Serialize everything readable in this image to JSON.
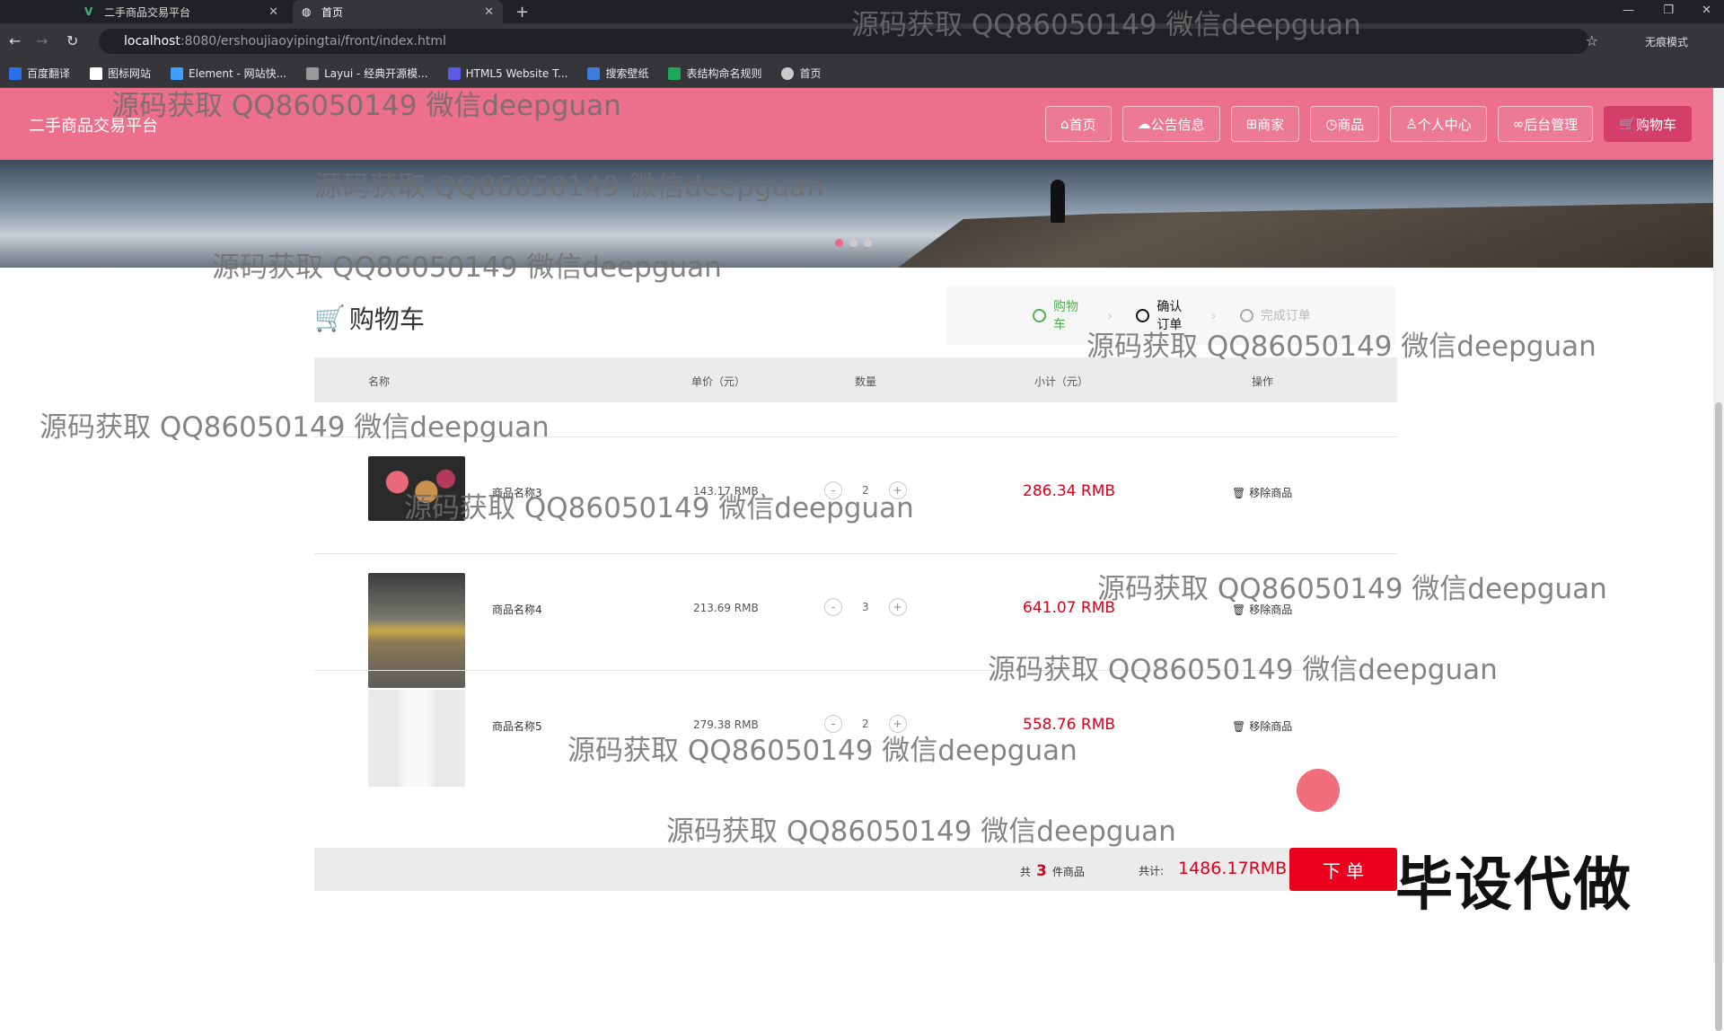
{
  "browser": {
    "tabs": [
      {
        "title": "二手商品交易平台"
      },
      {
        "title": "首页"
      }
    ],
    "url_host": "localhost",
    "url_path": ":8080/ershoujiaoyipingtai/front/index.html",
    "profile_label": "无痕模式",
    "bookmarks": [
      "百度翻译",
      "图标网站",
      "Element - 网站快...",
      "Layui - 经典开源模...",
      "HTML5 Website T...",
      "搜索壁纸",
      "表结构命名规则",
      "首页"
    ]
  },
  "header": {
    "site_title": "二手商品交易平台",
    "nav": [
      "首页",
      "公告信息",
      "商家",
      "商品",
      "个人中心",
      "后台管理",
      "购物车"
    ]
  },
  "cart": {
    "title": "购物车",
    "steps": [
      "购物车",
      "确认订单",
      "完成订单"
    ],
    "columns": [
      "名称",
      "单价（元）",
      "数量",
      "小计（元）",
      "操作"
    ],
    "items": [
      {
        "name": "商品名称3",
        "price": "143.17 RMB",
        "qty": "2",
        "subtotal": "286.34 RMB",
        "action": "移除商品"
      },
      {
        "name": "商品名称4",
        "price": "213.69 RMB",
        "qty": "3",
        "subtotal": "641.07 RMB",
        "action": "移除商品"
      },
      {
        "name": "商品名称5",
        "price": "279.38 RMB",
        "qty": "2",
        "subtotal": "558.76 RMB",
        "action": "移除商品"
      }
    ],
    "footer": {
      "count_prefix": "共",
      "count": "3",
      "count_suffix": "件商品",
      "total_label": "共计:",
      "total": "1486.17RMB",
      "order_label": "下 单"
    }
  },
  "overlays": {
    "watermark": "源码获取 QQ86050149 微信deepguan",
    "stamp": "毕设代做"
  },
  "colors": {
    "header": "#ec6f8c",
    "price_red": "#d9001b",
    "order_btn": "#e8001c"
  }
}
